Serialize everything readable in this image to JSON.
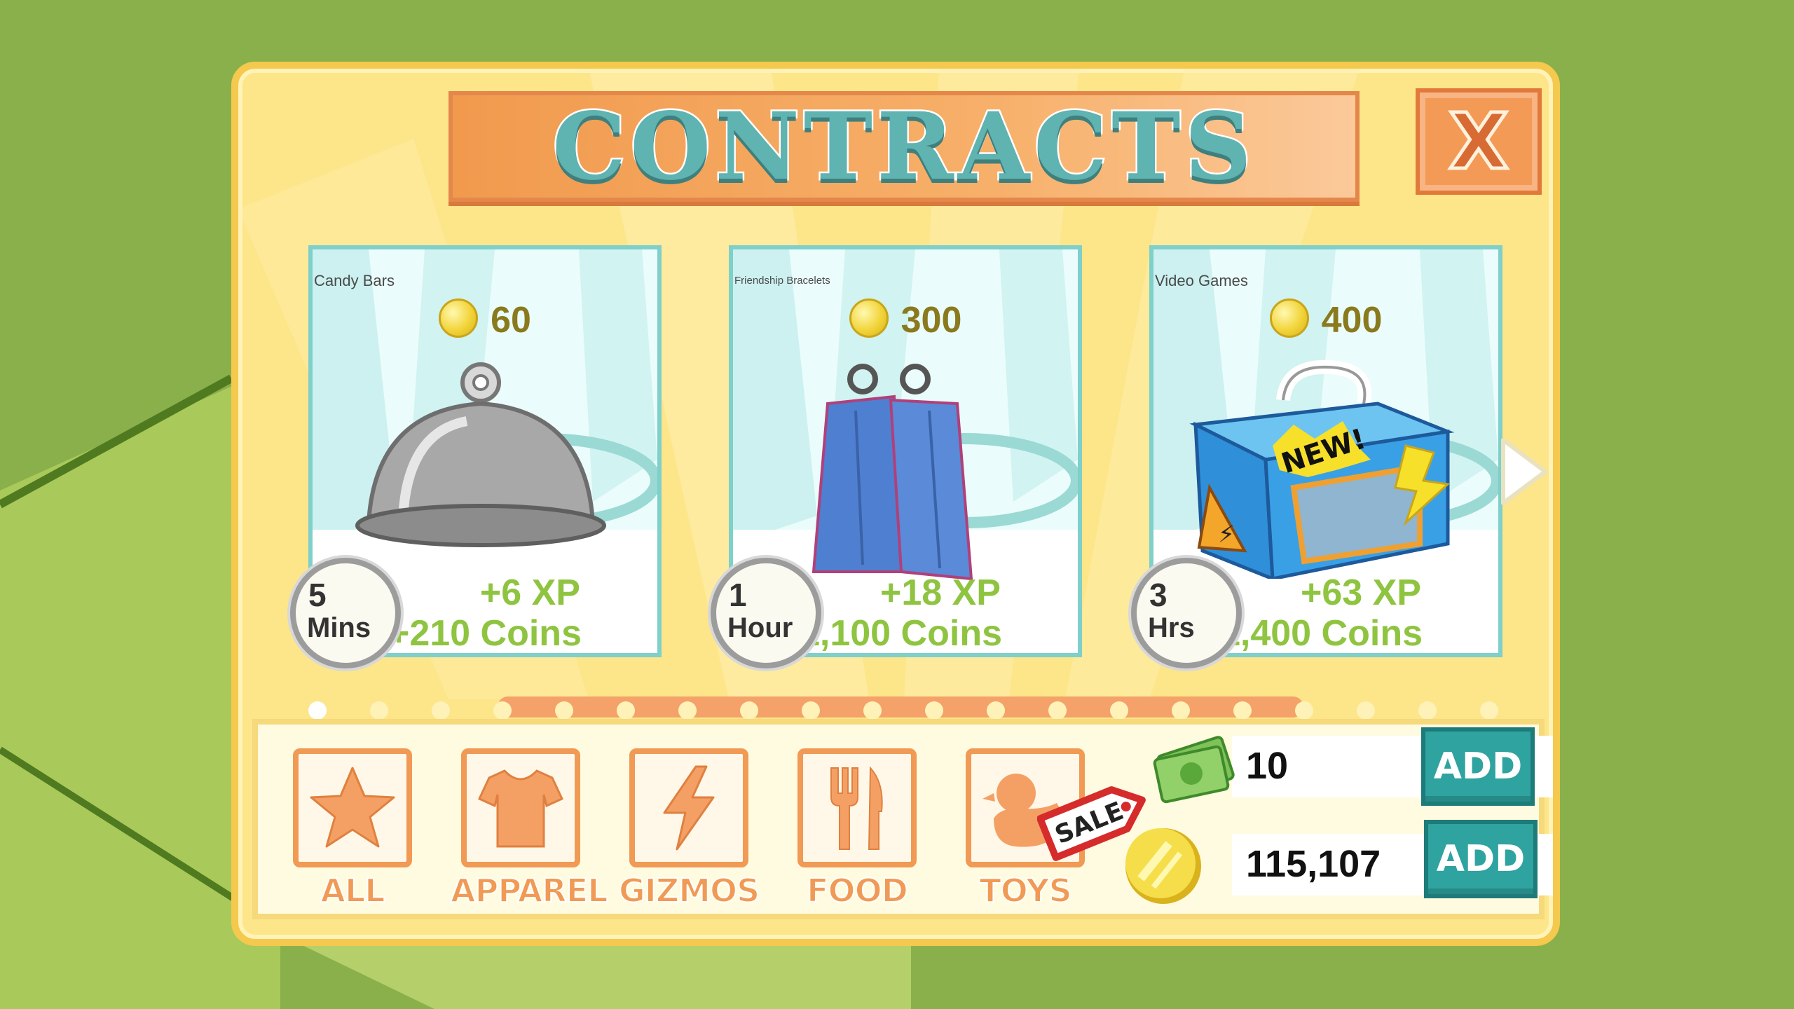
{
  "window": {
    "title": "CONTRACTS",
    "close_label": "X"
  },
  "contracts": [
    {
      "name": "Candy Bars",
      "cost": "60",
      "time_num": "5",
      "time_unit": "Mins",
      "xp": "+6 XP",
      "coins": "+210 Coins",
      "image": "cloche-icon"
    },
    {
      "name": "Friendship Bracelets",
      "cost": "300",
      "time_num": "1",
      "time_unit": "Hour",
      "xp": "+18 XP",
      "coins": "+1,100 Coins",
      "image": "garment-bag-icon"
    },
    {
      "name": "Video Games",
      "cost": "400",
      "time_num": "3",
      "time_unit": "Hrs",
      "xp": "+63 XP",
      "coins": "+1,400 Coins",
      "image": "crate-icon",
      "badge": "NEW!"
    }
  ],
  "pagination": {
    "total": 20,
    "active": 0
  },
  "categories": [
    {
      "label": "ALL",
      "icon": "star-icon"
    },
    {
      "label": "APPAREL",
      "icon": "shirt-icon"
    },
    {
      "label": "GIZMOS",
      "icon": "lightning-icon"
    },
    {
      "label": "FOOD",
      "icon": "fork-knife-icon"
    },
    {
      "label": "TOYS",
      "icon": "rubber-duck-icon"
    }
  ],
  "sale_tag": "SALE",
  "currency": {
    "cash": {
      "value": "10",
      "add_label": "ADD",
      "icon": "cash-icon"
    },
    "coins": {
      "value": "115,107",
      "add_label": "ADD",
      "icon": "coin-icon"
    }
  },
  "colors": {
    "accent": "#f09a55",
    "teal": "#2fa3a0",
    "panel": "#fde58a",
    "xp_green": "#8fc441"
  }
}
